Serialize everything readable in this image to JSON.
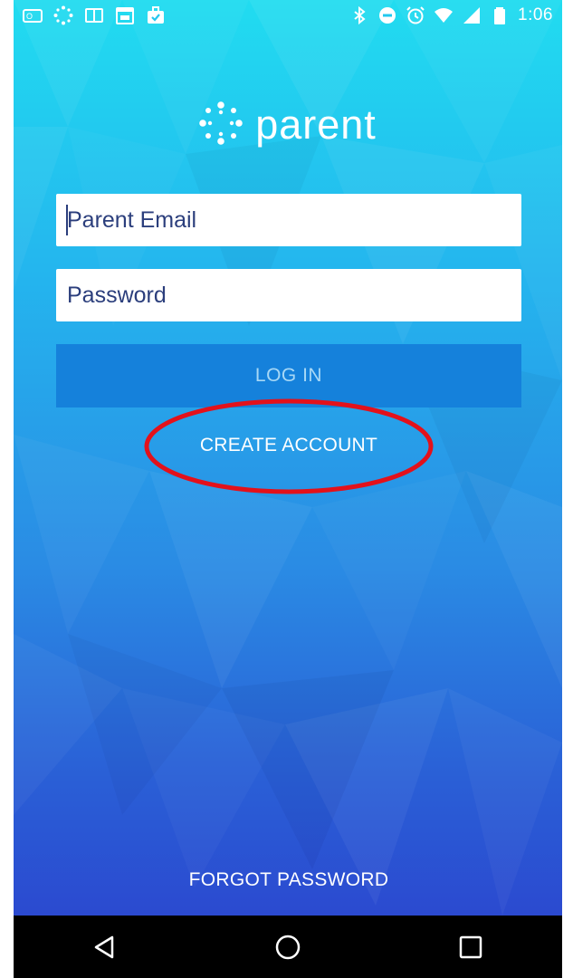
{
  "status_bar": {
    "time": "1:06",
    "left_icons": [
      "outlook-icon",
      "canvas-icon",
      "book-icon",
      "calendar-icon",
      "briefcase-icon"
    ],
    "right_icons": [
      "bluetooth-icon",
      "do-not-disturb-icon",
      "alarm-icon",
      "wifi-icon",
      "signal-icon",
      "battery-icon"
    ]
  },
  "logo": {
    "text": "parent"
  },
  "login_form": {
    "email_placeholder": "Parent Email",
    "password_placeholder": "Password",
    "login_label": "LOG IN",
    "create_account_label": "CREATE ACCOUNT",
    "forgot_password_label": "FORGOT PASSWORD"
  },
  "colors": {
    "gradient_top": "#21dcf0",
    "gradient_bottom": "#2b4ad0",
    "login_button": "#1581db",
    "annotation_ellipse": "#e3111b"
  },
  "nav_bar": {
    "buttons": [
      "back-icon",
      "home-icon",
      "recents-icon"
    ]
  }
}
